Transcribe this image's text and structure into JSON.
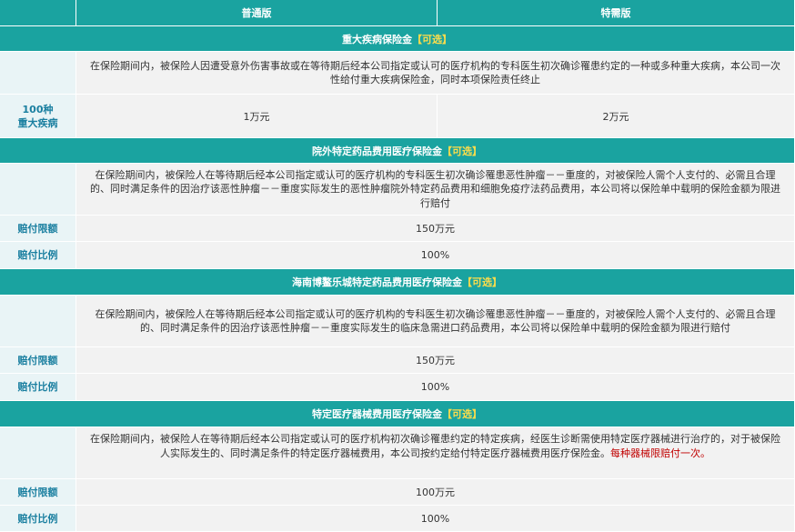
{
  "header": {
    "col_standard": "普通版",
    "col_special": "特需版"
  },
  "sections": {
    "critical": {
      "title": "重大疾病保险金",
      "optional": "【可选】",
      "description": "在保险期间内，被保险人因遭受意外伤害事故或在等待期后经本公司指定或认可的医疗机构的专科医生初次确诊罹患约定的一种或多种重大疾病，本公司一次性给付重大疾病保险金，同时本项保险责任终止",
      "row_label": "100种\n重大疾病",
      "standard": "1万元",
      "special": "2万元"
    },
    "outpatient": {
      "title": "院外特定药品费用医疗保险金",
      "optional": "【可选】",
      "description": "在保险期间内，被保险人在等待期后经本公司指定或认可的医疗机构的专科医生初次确诊罹患恶性肿瘤－－重度的，对被保险人需个人支付的、必需且合理的、同时满足条件的因治疗该恶性肿瘤－－重度实际发生的恶性肿瘤院外特定药品费用和细胞免疫疗法药品费用，本公司将以保险单中载明的保险金额为限进行赔付",
      "limit_label": "赔付限额",
      "limit_value": "150万元",
      "ratio_label": "赔付比例",
      "ratio_value": "100%"
    },
    "boao": {
      "title": "海南博鳌乐城特定药品费用医疗保险金",
      "optional": "【可选】",
      "description": "在保险期间内，被保险人在等待期后经本公司指定或认可的医疗机构的专科医生初次确诊罹患恶性肿瘤－－重度的，对被保险人需个人支付的、必需且合理的、同时满足条件的因治疗该恶性肿瘤－－重度实际发生的临床急需进口药品费用，本公司将以保险单中载明的保险金额为限进行赔付",
      "limit_label": "赔付限额",
      "limit_value": "150万元",
      "ratio_label": "赔付比例",
      "ratio_value": "100%"
    },
    "device": {
      "title": "特定医疗器械费用医疗保险金",
      "optional": "【可选】",
      "description": "在保险期间内，被保险人在等待期后经本公司指定或认可的医疗机构初次确诊罹患约定的特定疾病，经医生诊断需使用特定医疗器械进行治疗的，对于被保险人实际发生的、同时满足条件的特定医疗器械费用，本公司按约定给付特定医疗器械费用医疗保险金。",
      "note": "每种器械限赔付一次。",
      "limit_label": "赔付限额",
      "limit_value": "100万元",
      "ratio_label": "赔付比例",
      "ratio_value": "100%"
    }
  },
  "colors": {
    "teal": "#1aa3a0",
    "label_bg": "#e9f4f6",
    "label_text": "#1a7fa0",
    "optional": "#ffdd4a",
    "note": "#c00000"
  }
}
